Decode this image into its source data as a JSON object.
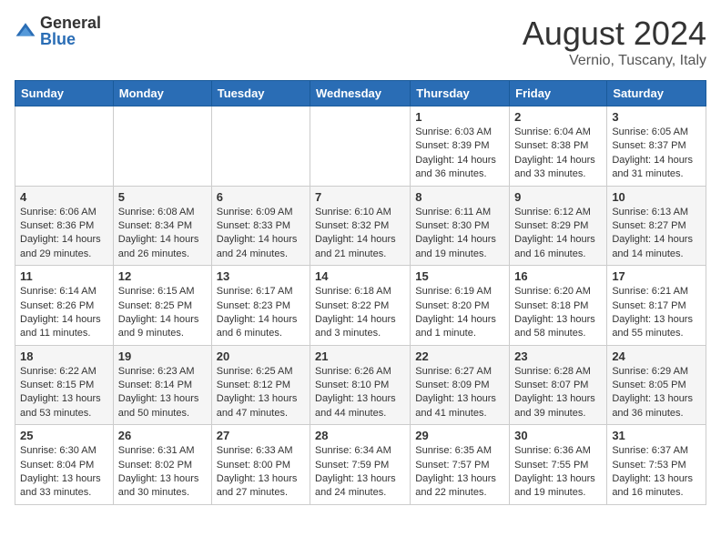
{
  "logo": {
    "general": "General",
    "blue": "Blue"
  },
  "title": "August 2024",
  "subtitle": "Vernio, Tuscany, Italy",
  "days_of_week": [
    "Sunday",
    "Monday",
    "Tuesday",
    "Wednesday",
    "Thursday",
    "Friday",
    "Saturday"
  ],
  "weeks": [
    [
      {
        "day": "",
        "info": ""
      },
      {
        "day": "",
        "info": ""
      },
      {
        "day": "",
        "info": ""
      },
      {
        "day": "",
        "info": ""
      },
      {
        "day": "1",
        "info": "Sunrise: 6:03 AM\nSunset: 8:39 PM\nDaylight: 14 hours and 36 minutes."
      },
      {
        "day": "2",
        "info": "Sunrise: 6:04 AM\nSunset: 8:38 PM\nDaylight: 14 hours and 33 minutes."
      },
      {
        "day": "3",
        "info": "Sunrise: 6:05 AM\nSunset: 8:37 PM\nDaylight: 14 hours and 31 minutes."
      }
    ],
    [
      {
        "day": "4",
        "info": "Sunrise: 6:06 AM\nSunset: 8:36 PM\nDaylight: 14 hours and 29 minutes."
      },
      {
        "day": "5",
        "info": "Sunrise: 6:08 AM\nSunset: 8:34 PM\nDaylight: 14 hours and 26 minutes."
      },
      {
        "day": "6",
        "info": "Sunrise: 6:09 AM\nSunset: 8:33 PM\nDaylight: 14 hours and 24 minutes."
      },
      {
        "day": "7",
        "info": "Sunrise: 6:10 AM\nSunset: 8:32 PM\nDaylight: 14 hours and 21 minutes."
      },
      {
        "day": "8",
        "info": "Sunrise: 6:11 AM\nSunset: 8:30 PM\nDaylight: 14 hours and 19 minutes."
      },
      {
        "day": "9",
        "info": "Sunrise: 6:12 AM\nSunset: 8:29 PM\nDaylight: 14 hours and 16 minutes."
      },
      {
        "day": "10",
        "info": "Sunrise: 6:13 AM\nSunset: 8:27 PM\nDaylight: 14 hours and 14 minutes."
      }
    ],
    [
      {
        "day": "11",
        "info": "Sunrise: 6:14 AM\nSunset: 8:26 PM\nDaylight: 14 hours and 11 minutes."
      },
      {
        "day": "12",
        "info": "Sunrise: 6:15 AM\nSunset: 8:25 PM\nDaylight: 14 hours and 9 minutes."
      },
      {
        "day": "13",
        "info": "Sunrise: 6:17 AM\nSunset: 8:23 PM\nDaylight: 14 hours and 6 minutes."
      },
      {
        "day": "14",
        "info": "Sunrise: 6:18 AM\nSunset: 8:22 PM\nDaylight: 14 hours and 3 minutes."
      },
      {
        "day": "15",
        "info": "Sunrise: 6:19 AM\nSunset: 8:20 PM\nDaylight: 14 hours and 1 minute."
      },
      {
        "day": "16",
        "info": "Sunrise: 6:20 AM\nSunset: 8:18 PM\nDaylight: 13 hours and 58 minutes."
      },
      {
        "day": "17",
        "info": "Sunrise: 6:21 AM\nSunset: 8:17 PM\nDaylight: 13 hours and 55 minutes."
      }
    ],
    [
      {
        "day": "18",
        "info": "Sunrise: 6:22 AM\nSunset: 8:15 PM\nDaylight: 13 hours and 53 minutes."
      },
      {
        "day": "19",
        "info": "Sunrise: 6:23 AM\nSunset: 8:14 PM\nDaylight: 13 hours and 50 minutes."
      },
      {
        "day": "20",
        "info": "Sunrise: 6:25 AM\nSunset: 8:12 PM\nDaylight: 13 hours and 47 minutes."
      },
      {
        "day": "21",
        "info": "Sunrise: 6:26 AM\nSunset: 8:10 PM\nDaylight: 13 hours and 44 minutes."
      },
      {
        "day": "22",
        "info": "Sunrise: 6:27 AM\nSunset: 8:09 PM\nDaylight: 13 hours and 41 minutes."
      },
      {
        "day": "23",
        "info": "Sunrise: 6:28 AM\nSunset: 8:07 PM\nDaylight: 13 hours and 39 minutes."
      },
      {
        "day": "24",
        "info": "Sunrise: 6:29 AM\nSunset: 8:05 PM\nDaylight: 13 hours and 36 minutes."
      }
    ],
    [
      {
        "day": "25",
        "info": "Sunrise: 6:30 AM\nSunset: 8:04 PM\nDaylight: 13 hours and 33 minutes."
      },
      {
        "day": "26",
        "info": "Sunrise: 6:31 AM\nSunset: 8:02 PM\nDaylight: 13 hours and 30 minutes."
      },
      {
        "day": "27",
        "info": "Sunrise: 6:33 AM\nSunset: 8:00 PM\nDaylight: 13 hours and 27 minutes."
      },
      {
        "day": "28",
        "info": "Sunrise: 6:34 AM\nSunset: 7:59 PM\nDaylight: 13 hours and 24 minutes."
      },
      {
        "day": "29",
        "info": "Sunrise: 6:35 AM\nSunset: 7:57 PM\nDaylight: 13 hours and 22 minutes."
      },
      {
        "day": "30",
        "info": "Sunrise: 6:36 AM\nSunset: 7:55 PM\nDaylight: 13 hours and 19 minutes."
      },
      {
        "day": "31",
        "info": "Sunrise: 6:37 AM\nSunset: 7:53 PM\nDaylight: 13 hours and 16 minutes."
      }
    ]
  ]
}
